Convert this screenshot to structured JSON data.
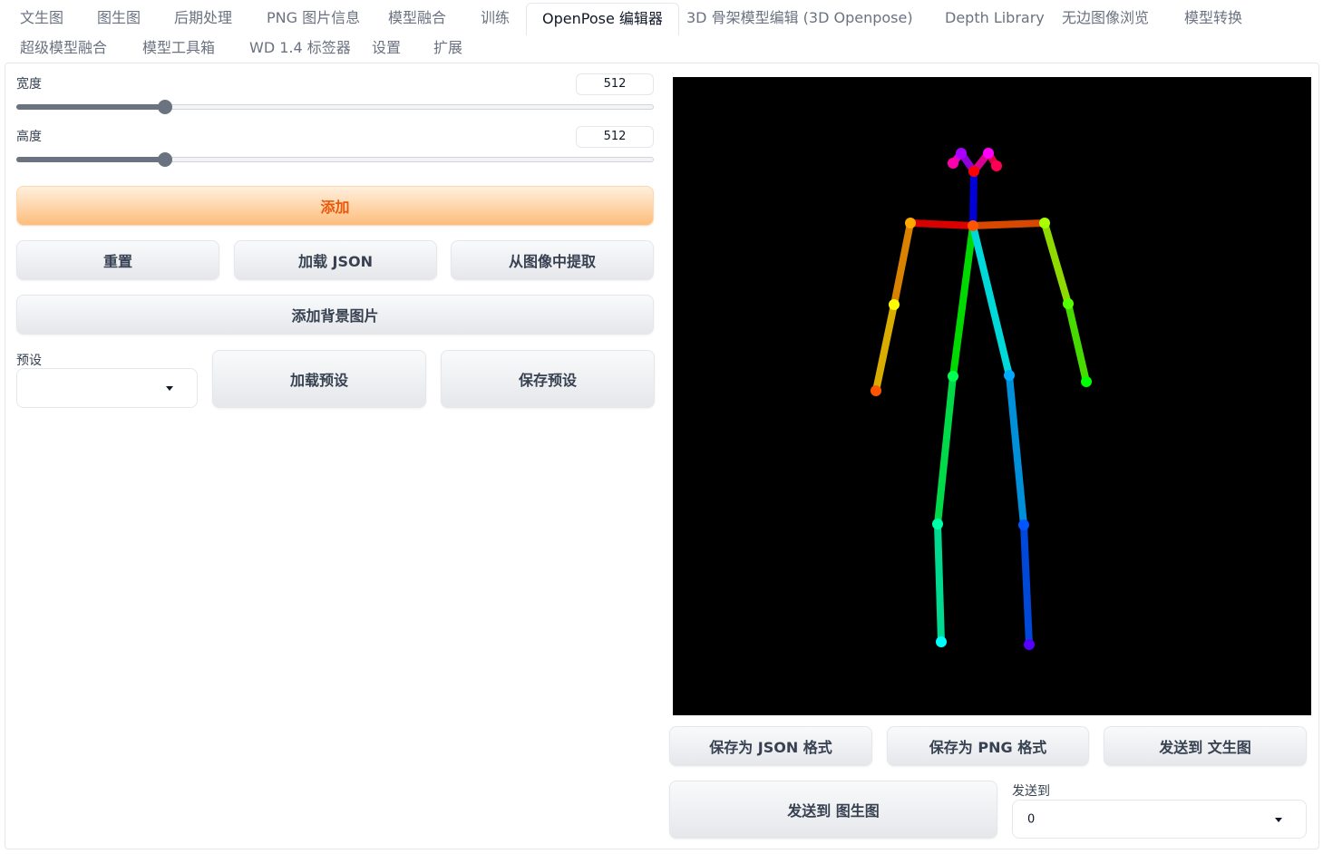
{
  "tabs": [
    {
      "label": "文生图"
    },
    {
      "label": "图生图"
    },
    {
      "label": "后期处理"
    },
    {
      "label": "PNG 图片信息"
    },
    {
      "label": "模型融合"
    },
    {
      "label": "训练"
    },
    {
      "label": "OpenPose 编辑器"
    },
    {
      "label": "3D 骨架模型编辑 (3D Openpose)"
    },
    {
      "label": "Depth Library"
    },
    {
      "label": "无边图像浏览"
    },
    {
      "label": "模型转换"
    },
    {
      "label": "超级模型融合"
    },
    {
      "label": "模型工具箱"
    },
    {
      "label": "WD 1.4 标签器"
    },
    {
      "label": "设置"
    },
    {
      "label": "扩展"
    }
  ],
  "left": {
    "width": {
      "label": "宽度",
      "value": "512",
      "slider_fraction": 0.233
    },
    "height": {
      "label": "高度",
      "value": "512",
      "slider_fraction": 0.233
    },
    "add_label": "添加",
    "reset_label": "重置",
    "load_json_label": "加载 JSON",
    "extract_label": "从图像中提取",
    "add_bg_label": "添加背景图片",
    "preset_label": "预设",
    "preset_value": "",
    "load_preset_label": "加载预设",
    "save_preset_label": "保存预设"
  },
  "right": {
    "save_json_label": "保存为 JSON 格式",
    "save_png_label": "保存为 PNG 格式",
    "send_txt2img_label": "发送到 文生图",
    "send_img2img_label": "发送到 图生图",
    "send_to_label": "发送到",
    "send_to_value": "0"
  },
  "colors": {
    "accent": "#ea580c",
    "canvas_bg": "#000000"
  }
}
